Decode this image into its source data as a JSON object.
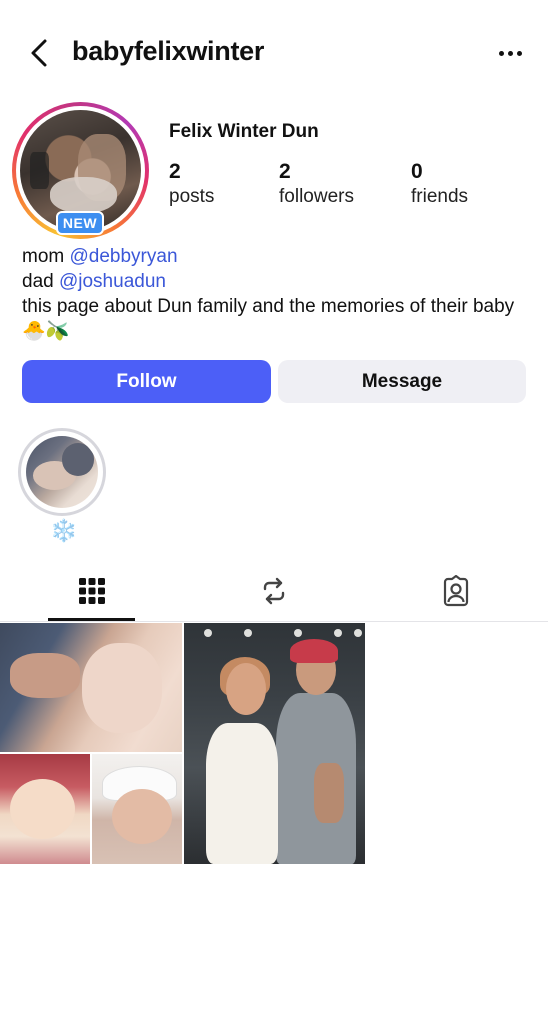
{
  "header": {
    "username": "babyfelixwinter",
    "back_icon": "chevron-left-icon",
    "more_icon": "more-horizontal-icon"
  },
  "profile": {
    "display_name": "Felix Winter Dun",
    "new_badge": "NEW",
    "stats": [
      {
        "value": "2",
        "label": "posts"
      },
      {
        "value": "2",
        "label": "followers"
      },
      {
        "value": "0",
        "label": "friends"
      }
    ]
  },
  "bio": {
    "line1_prefix": "mom ",
    "line1_link": "@debbyryan",
    "line2_prefix": "dad ",
    "line2_link": "@joshuadun",
    "line3": "this page about Dun family and the memories of their baby 🐣🫒"
  },
  "actions": {
    "follow_label": "Follow",
    "message_label": "Message"
  },
  "highlights": [
    {
      "label": "❄️"
    }
  ],
  "tabs": [
    {
      "icon": "grid-icon",
      "active": true
    },
    {
      "icon": "repost-icon",
      "active": false
    },
    {
      "icon": "tagged-person-icon",
      "active": false
    }
  ],
  "colors": {
    "follow_button": "#4c5ff7",
    "message_button": "#efeff4",
    "link": "#3b57d8",
    "new_badge": "#3d8ef0"
  }
}
